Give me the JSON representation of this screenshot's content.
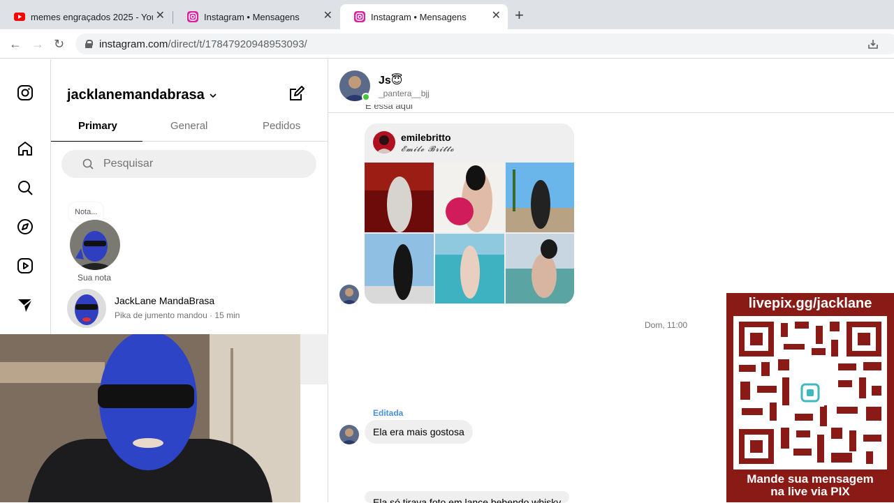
{
  "browser": {
    "tabs": [
      {
        "title": "memes engraçados 2025 - YouTube",
        "favicon": "youtube-icon",
        "active": false
      },
      {
        "title": "Instagram • Mensagens",
        "favicon": "instagram-icon",
        "active": false
      },
      {
        "title": "Instagram • Mensagens",
        "favicon": "instagram-icon",
        "active": true
      }
    ],
    "url_domain": "instagram.com",
    "url_path": "/direct/t/17847920948953093/"
  },
  "sidebar": {
    "icons": [
      "instagram-logo-icon",
      "home-icon",
      "search-icon",
      "explore-icon",
      "reels-icon",
      "messages-icon"
    ]
  },
  "inbox": {
    "username": "jacklanemandabrasa",
    "tabs": [
      "Primary",
      "General",
      "Pedidos"
    ],
    "search_placeholder": "Pesquisar",
    "note_text": "Nota...",
    "note_label": "Sua nota",
    "conversations": [
      {
        "name": "JackLane MandaBrasa",
        "preview": "Pika de jumento mandou · 15 min"
      }
    ]
  },
  "chat": {
    "name": "Js😇",
    "handle": "_pantera__bjj",
    "prev_text": "É essa aqui",
    "shared_profile": {
      "username": "emilebritto",
      "fullname": "𝓔𝓶𝓲𝓵𝓮 𝓑𝓻𝓲𝓽𝓽𝓸"
    },
    "timestamp": "Dom, 11:00",
    "edited_label": "Editada",
    "message": "Ela era mais gostosa",
    "cut_message": "Ela só tirava foto em lance bebendo whisky"
  },
  "overlay": {
    "pix_url": "livepix.gg/jacklane",
    "pix_caption_1": "Mande sua mensagem",
    "pix_caption_2": "na live via PIX"
  },
  "colors": {
    "accent_red": "#8a1a15",
    "online_green": "#44c93c",
    "edited_blue": "#4a90d9"
  }
}
